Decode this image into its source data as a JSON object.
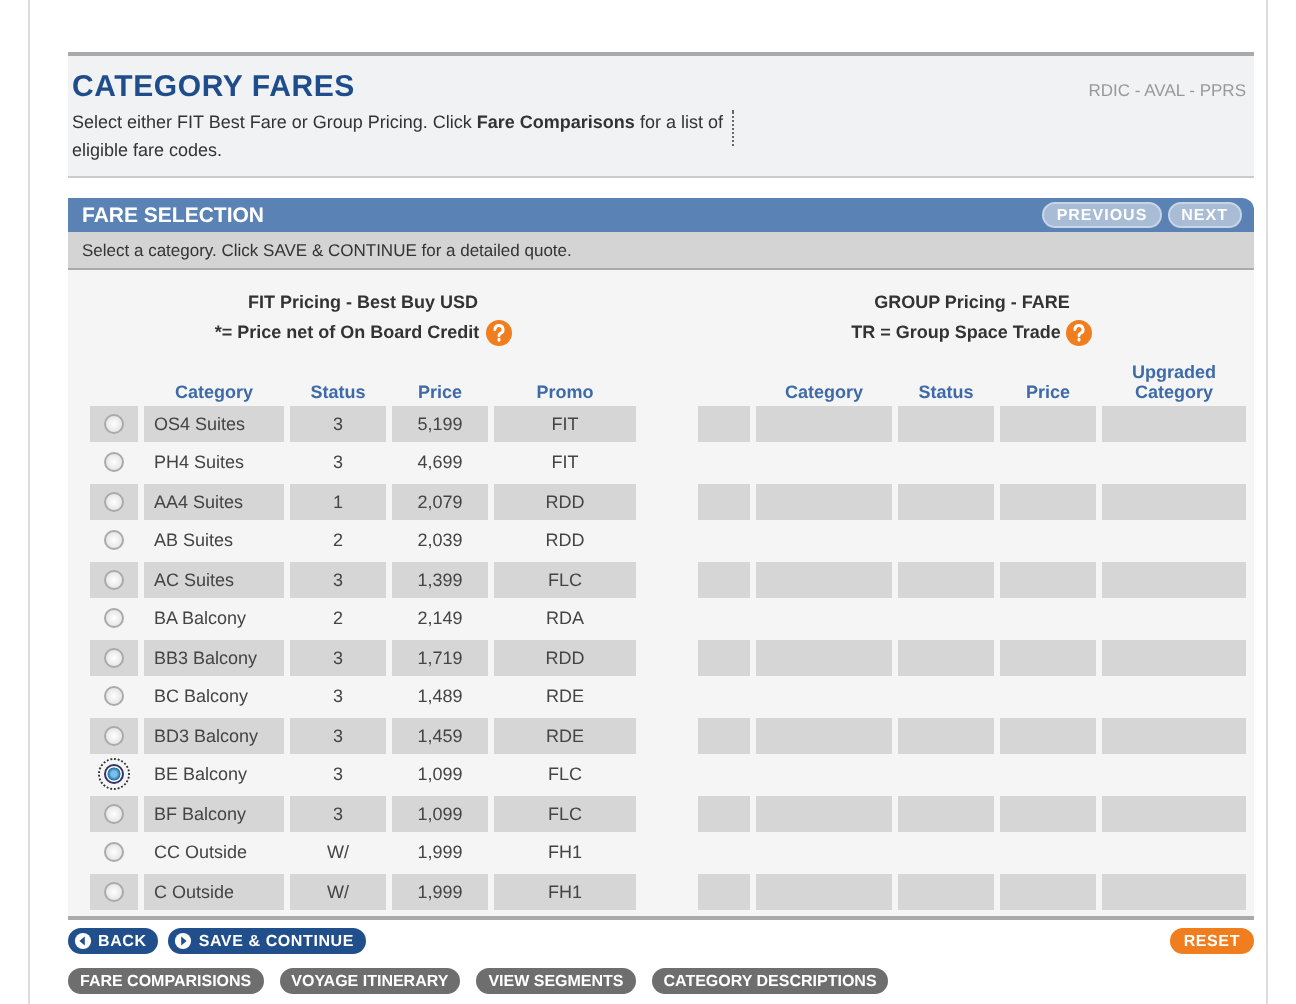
{
  "header": {
    "title": "CATEGORY FARES",
    "description": "Select either FIT Best Fare or Group Pricing. Click **Fare Comparisons** for a list of eligible fare codes.",
    "codes": "RDIC - AVAL - PPRS"
  },
  "panel": {
    "title": "FARE SELECTION",
    "nav": [
      "PREVIOUS",
      "NEXT"
    ],
    "instruction": "Select a category. Click SAVE & CONTINUE for a detailed quote."
  },
  "fit": {
    "title": "FIT Pricing - Best Buy USD",
    "note": "*= Price net of On Board Credit",
    "columns": [
      "Category",
      "Status",
      "Price",
      "Promo"
    ],
    "rows": [
      {
        "category": "OS4 Suites",
        "status": "3",
        "price": "5,199",
        "promo": "FIT",
        "selected": false
      },
      {
        "category": "PH4 Suites",
        "status": "3",
        "price": "4,699",
        "promo": "FIT",
        "selected": false
      },
      {
        "category": "AA4 Suites",
        "status": "1",
        "price": "2,079",
        "promo": "RDD",
        "selected": false
      },
      {
        "category": "AB Suites",
        "status": "2",
        "price": "2,039",
        "promo": "RDD",
        "selected": false
      },
      {
        "category": "AC Suites",
        "status": "3",
        "price": "1,399",
        "promo": "FLC",
        "selected": false
      },
      {
        "category": "BA Balcony",
        "status": "2",
        "price": "2,149",
        "promo": "RDA",
        "selected": false
      },
      {
        "category": "BB3 Balcony",
        "status": "3",
        "price": "1,719",
        "promo": "RDD",
        "selected": false
      },
      {
        "category": "BC Balcony",
        "status": "3",
        "price": "1,489",
        "promo": "RDE",
        "selected": false
      },
      {
        "category": "BD3 Balcony",
        "status": "3",
        "price": "1,459",
        "promo": "RDE",
        "selected": false
      },
      {
        "category": "BE Balcony",
        "status": "3",
        "price": "1,099",
        "promo": "FLC",
        "selected": true
      },
      {
        "category": "BF Balcony",
        "status": "3",
        "price": "1,099",
        "promo": "FLC",
        "selected": false
      },
      {
        "category": "CC Outside",
        "status": "W/",
        "price": "1,999",
        "promo": "FH1",
        "selected": false
      },
      {
        "category": "C Outside",
        "status": "W/",
        "price": "1,999",
        "promo": "FH1",
        "selected": false
      }
    ]
  },
  "group": {
    "title": "GROUP Pricing - FARE",
    "note": "TR = Group Space Trade",
    "columns": [
      "Category",
      "Status",
      "Price",
      "Upgraded Category"
    ]
  },
  "actions": [
    {
      "label": "BACK",
      "kind": "back"
    },
    {
      "label": "SAVE & CONTINUE",
      "kind": "forward"
    },
    {
      "label": "RESET",
      "kind": "reset"
    }
  ],
  "links": [
    "FARE COMPARISIONS",
    "VOYAGE ITINERARY",
    "VIEW SEGMENTS",
    "CATEGORY DESCRIPTIONS"
  ]
}
